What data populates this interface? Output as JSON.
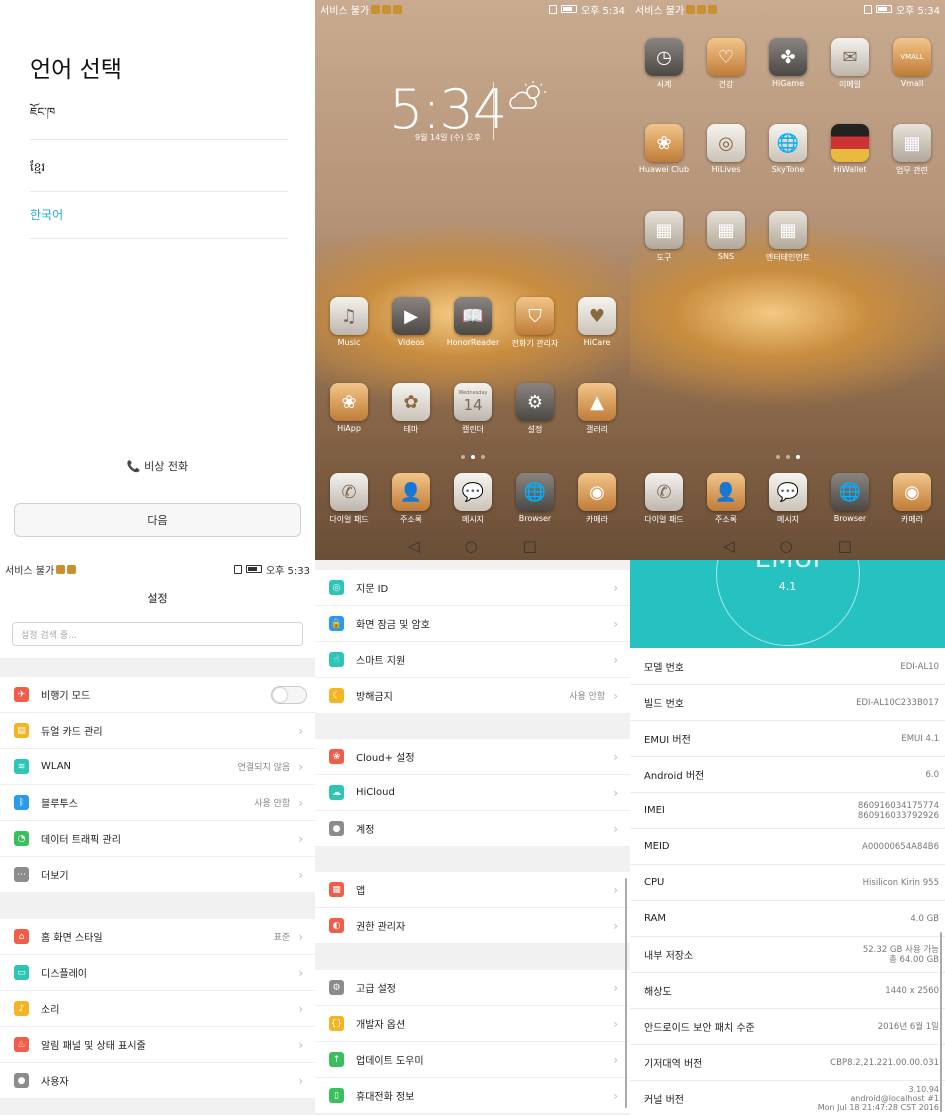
{
  "status": {
    "service": "서비스 불가",
    "time1": "오후 5:34",
    "time2": "오후 5:33"
  },
  "lang": {
    "title": "언어 선택",
    "items": [
      "ཇོང་ཁ",
      "ខ្មែរ",
      "한국어"
    ],
    "selected_color": "#24a8e0",
    "emergency": "비상 전화",
    "next": "다음"
  },
  "home1": {
    "time": "5:34",
    "date": "9월 14일 (수) 오후",
    "row1": [
      "Music",
      "Videos",
      "HonorReader",
      "전화기 관리자",
      "HiCare"
    ],
    "row2": [
      "HiApp",
      "테마",
      "캘린더",
      "설정",
      "갤러리"
    ],
    "calendar_day": "Wednesday",
    "calendar_num": "14",
    "dock": [
      "다이얼 패드",
      "주소록",
      "메시지",
      "Browser",
      "카메라"
    ]
  },
  "home2": {
    "row1": [
      "시계",
      "건강",
      "HiGame",
      "이메일",
      "Vmall"
    ],
    "row2": [
      "Huawei Club",
      "HiLives",
      "SkyTone",
      "HiWallet",
      "업무 관련"
    ],
    "row3": [
      "도구",
      "SNS",
      "엔터테인먼트"
    ],
    "vmall_text": "VMALL",
    "dock": [
      "다이얼 패드",
      "주소록",
      "메시지",
      "Browser",
      "카메라"
    ]
  },
  "settings": {
    "title": "설정",
    "search_placeholder": "설정 검색 중...",
    "g1": [
      {
        "label": "비행기 모드",
        "val": ""
      },
      {
        "label": "듀얼 카드 관리",
        "val": ""
      },
      {
        "label": "WLAN",
        "val": "연결되지 않음"
      },
      {
        "label": "블루투스",
        "val": "사용 안함"
      },
      {
        "label": "데이터 트래픽 관리",
        "val": ""
      },
      {
        "label": "더보기",
        "val": ""
      }
    ],
    "g2": [
      {
        "label": "홈 화면 스타일",
        "val": "표준"
      },
      {
        "label": "디스플레이",
        "val": ""
      },
      {
        "label": "소리",
        "val": ""
      },
      {
        "label": "알림 패널 및 상태 표시줄",
        "val": ""
      },
      {
        "label": "사용자",
        "val": ""
      }
    ]
  },
  "settings2": {
    "g1": [
      {
        "label": "지문 ID",
        "val": ""
      },
      {
        "label": "화면 잠금 및 암호",
        "val": ""
      },
      {
        "label": "스마트 지원",
        "val": ""
      },
      {
        "label": "방해금지",
        "val": "사용 안함"
      }
    ],
    "g2": [
      {
        "label": "Cloud+ 설정",
        "val": ""
      },
      {
        "label": "HiCloud",
        "val": ""
      },
      {
        "label": "계정",
        "val": ""
      }
    ],
    "g3": [
      {
        "label": "앱",
        "val": ""
      },
      {
        "label": "권한 관리자",
        "val": ""
      }
    ],
    "g4": [
      {
        "label": "고급 설정",
        "val": ""
      },
      {
        "label": "개발자 옵션",
        "val": ""
      },
      {
        "label": "업데이트 도우미",
        "val": ""
      },
      {
        "label": "휴대전화 정보",
        "val": ""
      }
    ]
  },
  "about": {
    "version_big": "EMUI",
    "version": "4.1",
    "rows": [
      {
        "label": "모델 번호",
        "v1": "EDI-AL10",
        "v2": "",
        "v3": ""
      },
      {
        "label": "빌드 번호",
        "v1": "EDI-AL10C233B017",
        "v2": "",
        "v3": ""
      },
      {
        "label": "EMUI 버전",
        "v1": "EMUI 4.1",
        "v2": "",
        "v3": ""
      },
      {
        "label": "Android 버전",
        "v1": "6.0",
        "v2": "",
        "v3": ""
      },
      {
        "label": "IMEI",
        "v1": "860916034175774",
        "v2": "860916033792926",
        "v3": ""
      },
      {
        "label": "MEID",
        "v1": "A00000654A84B6",
        "v2": "",
        "v3": ""
      },
      {
        "label": "CPU",
        "v1": "Hisilicon Kirin 955",
        "v2": "",
        "v3": ""
      },
      {
        "label": "RAM",
        "v1": "4.0 GB",
        "v2": "",
        "v3": ""
      },
      {
        "label": "내부 저장소",
        "v1": "52.32  GB 사용 가능",
        "v2": "총 64.00  GB",
        "v3": ""
      },
      {
        "label": "해상도",
        "v1": "1440 x 2560",
        "v2": "",
        "v3": ""
      },
      {
        "label": "안드로이드 보안 패치 수준",
        "v1": "2016년 6월 1일",
        "v2": "",
        "v3": ""
      },
      {
        "label": "기저대역 버전",
        "v1": "CBP8.2,21.221.00.00.031",
        "v2": "",
        "v3": ""
      },
      {
        "label": "커널 버전",
        "v1": "3.10.94",
        "v2": "android@localhost #1",
        "v3": "Mon Jul 18 21:47:28 CST 2016"
      }
    ]
  }
}
